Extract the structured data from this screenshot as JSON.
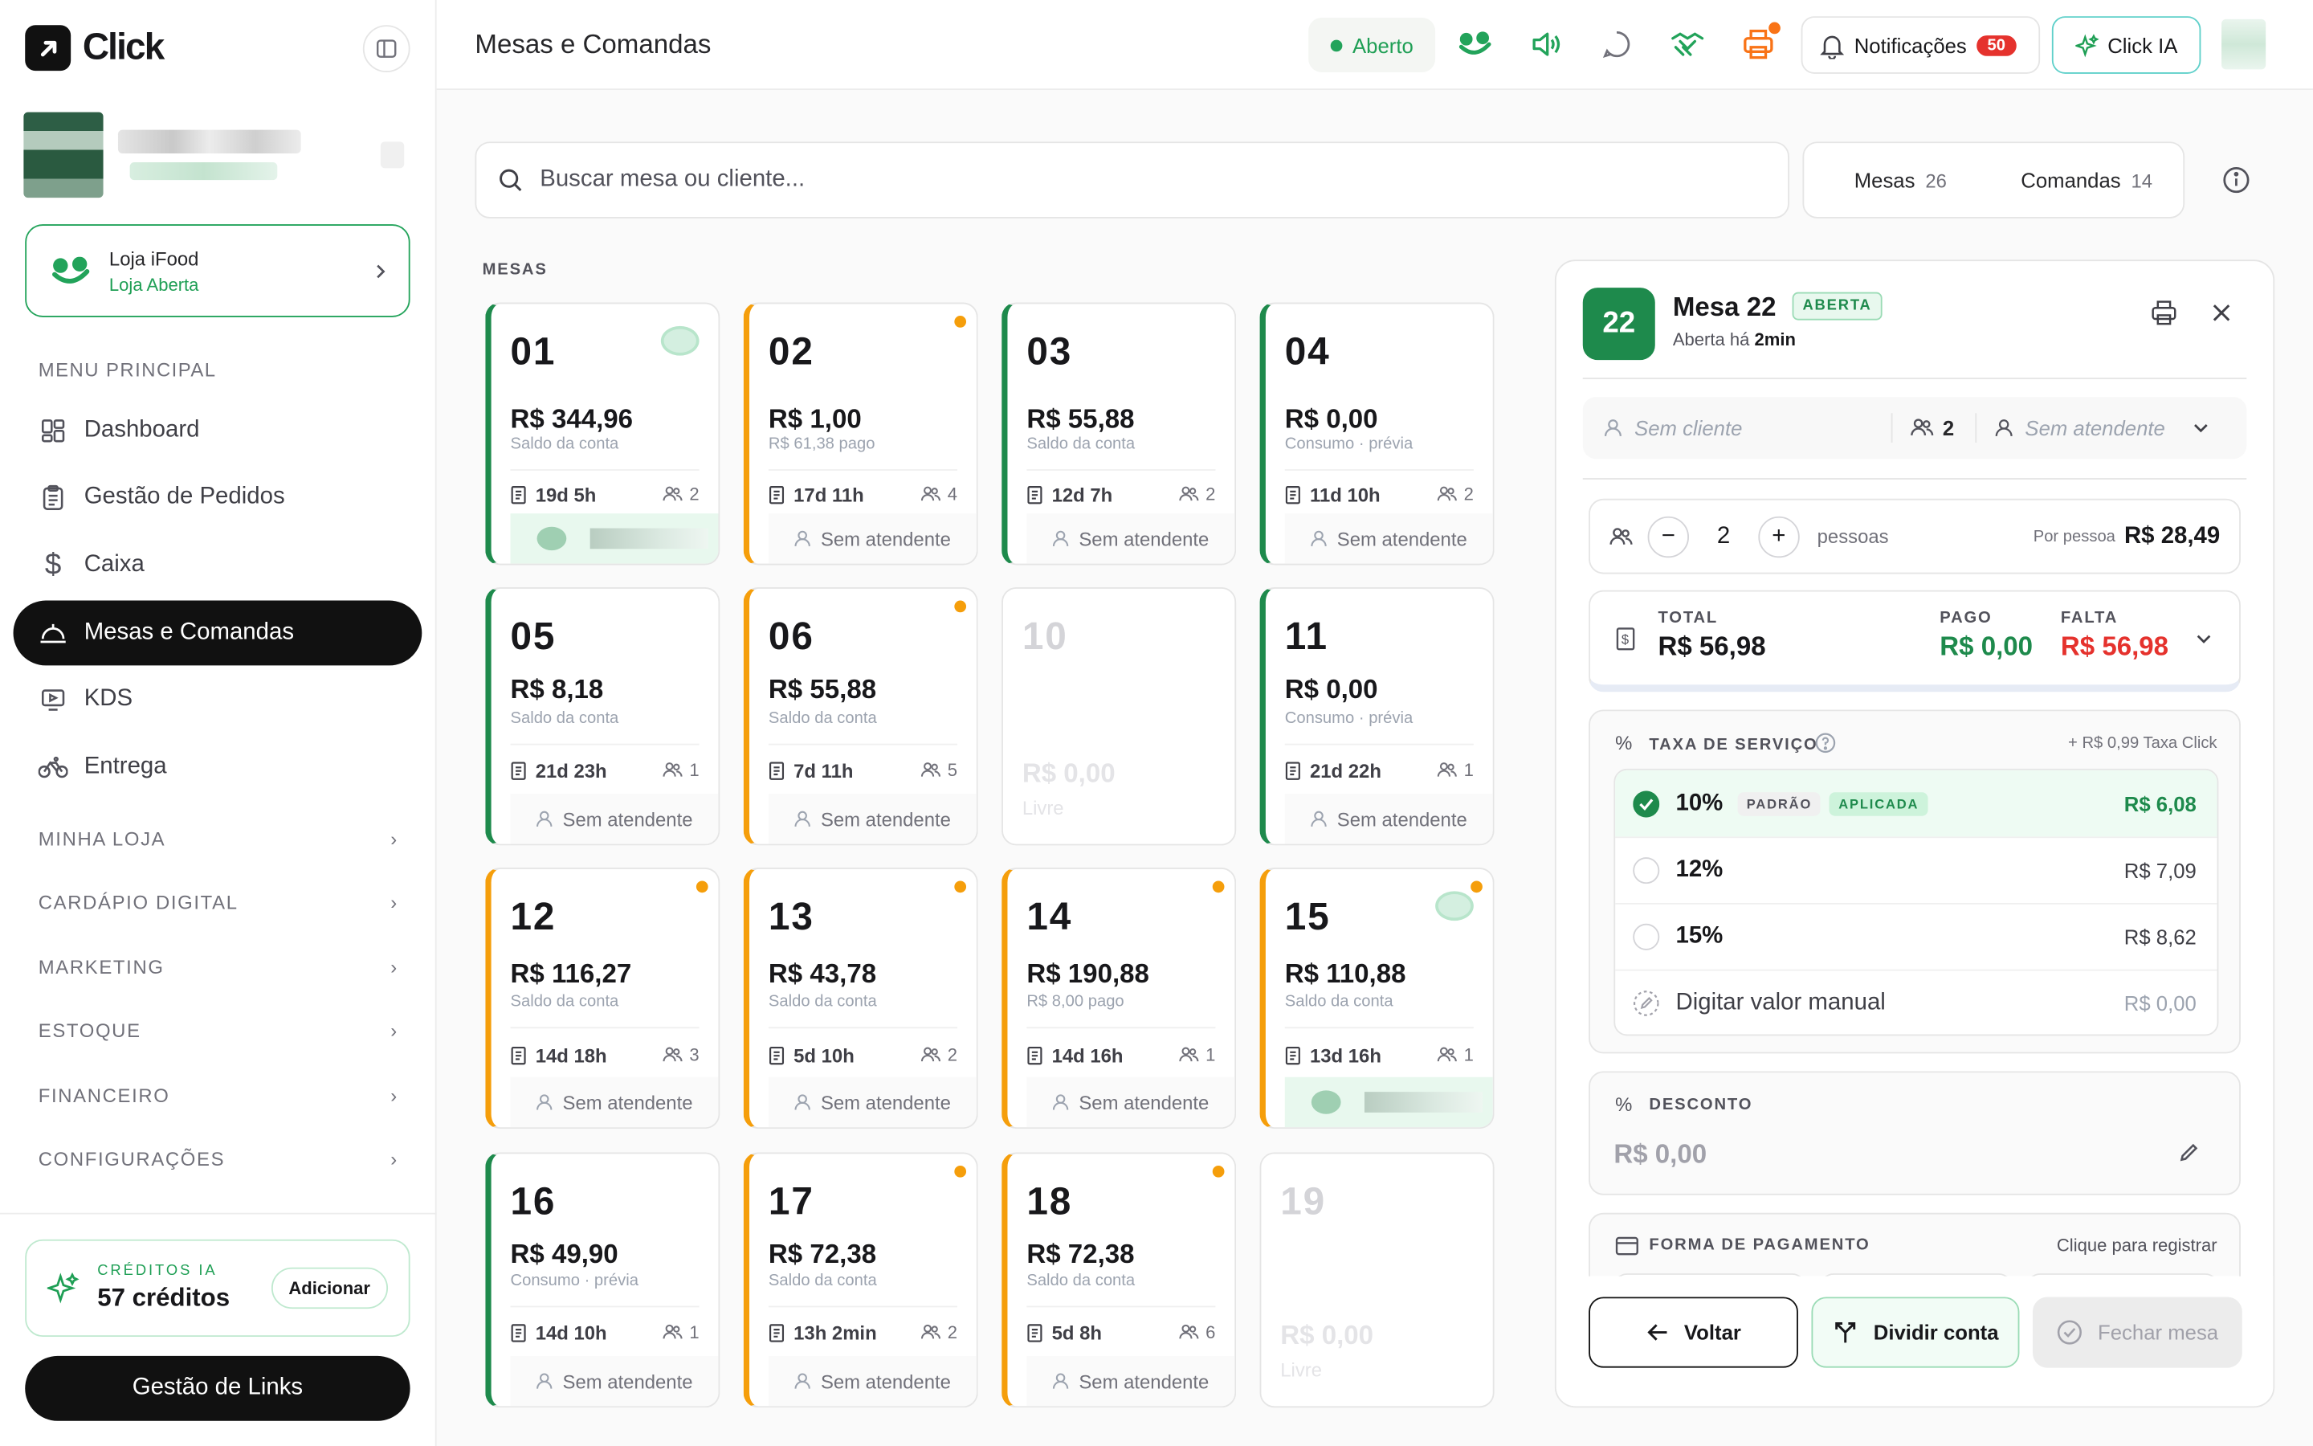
{
  "app": {
    "brand": "Click",
    "page_title": "Mesas e Comandas"
  },
  "sidebar": {
    "store": {
      "name": "Loja iFood",
      "status": "Loja Aberta"
    },
    "menu_label": "MENU PRINCIPAL",
    "items": [
      {
        "label": "Dashboard",
        "icon": "dashboard-icon"
      },
      {
        "label": "Gestão de Pedidos",
        "icon": "clipboard-icon"
      },
      {
        "label": "Caixa",
        "icon": "dollar-icon"
      },
      {
        "label": "Mesas e Comandas",
        "icon": "cloche-icon",
        "active": true
      },
      {
        "label": "KDS",
        "icon": "monitor-icon"
      },
      {
        "label": "Entrega",
        "icon": "bike-icon"
      }
    ],
    "groups": [
      "MINHA LOJA",
      "CARDÁPIO DIGITAL",
      "MARKETING",
      "ESTOQUE",
      "FINANCEIRO",
      "CONFIGURAÇÕES"
    ],
    "credits": {
      "label": "CRÉDITOS IA",
      "value": "57 créditos",
      "add_label": "Adicionar"
    },
    "links_button": "Gestão de Links"
  },
  "header": {
    "status": "Aberto",
    "notifications": {
      "label": "Notificações",
      "count": "50"
    },
    "ia_button": "Click IA"
  },
  "search": {
    "placeholder": "Buscar mesa ou cliente..."
  },
  "tabs": [
    {
      "label": "Mesas",
      "count": "26"
    },
    {
      "label": "Comandas",
      "count": "14"
    }
  ],
  "section_label": "MESAS",
  "tables": [
    {
      "num": "01",
      "amount": "R$ 344,96",
      "sub": "Saldo da conta",
      "time": "19d 5h",
      "people": "2",
      "attendant": "",
      "status": "open-green",
      "badge": true
    },
    {
      "num": "02",
      "amount": "R$ 1,00",
      "sub": "R$ 61,38 pago",
      "time": "17d 11h",
      "people": "4",
      "attendant": "Sem atendente",
      "status": "orange"
    },
    {
      "num": "03",
      "amount": "R$ 55,88",
      "sub": "Saldo da conta",
      "time": "12d 7h",
      "people": "2",
      "attendant": "Sem atendente",
      "status": "green"
    },
    {
      "num": "04",
      "amount": "R$ 0,00",
      "sub": "Consumo · prévia",
      "time": "11d 10h",
      "people": "2",
      "attendant": "Sem atendente",
      "status": "green"
    },
    {
      "num": "05",
      "amount": "R$ 8,18",
      "sub": "Saldo da conta",
      "time": "21d 23h",
      "people": "1",
      "attendant": "Sem atendente",
      "status": "green"
    },
    {
      "num": "06",
      "amount": "R$ 55,88",
      "sub": "Saldo da conta",
      "time": "7d 11h",
      "people": "5",
      "attendant": "Sem atendente",
      "status": "orange"
    },
    {
      "num": "10",
      "amount": "R$ 0,00",
      "sub": "Livre",
      "status": "free"
    },
    {
      "num": "11",
      "amount": "R$ 0,00",
      "sub": "Consumo · prévia",
      "time": "21d 22h",
      "people": "1",
      "attendant": "Sem atendente",
      "status": "green"
    },
    {
      "num": "12",
      "amount": "R$ 116,27",
      "sub": "Saldo da conta",
      "time": "14d 18h",
      "people": "3",
      "attendant": "Sem atendente",
      "status": "orange"
    },
    {
      "num": "13",
      "amount": "R$ 43,78",
      "sub": "Saldo da conta",
      "time": "5d 10h",
      "people": "2",
      "attendant": "Sem atendente",
      "status": "orange"
    },
    {
      "num": "14",
      "amount": "R$ 190,88",
      "sub": "R$ 8,00 pago",
      "time": "14d 16h",
      "people": "1",
      "attendant": "Sem atendente",
      "status": "orange"
    },
    {
      "num": "15",
      "amount": "R$ 110,88",
      "sub": "Saldo da conta",
      "time": "13d 16h",
      "people": "1",
      "attendant": "",
      "status": "orange",
      "badge": true
    },
    {
      "num": "16",
      "amount": "R$ 49,90",
      "sub": "Consumo · prévia",
      "time": "14d 10h",
      "people": "1",
      "attendant": "Sem atendente",
      "status": "green"
    },
    {
      "num": "17",
      "amount": "R$ 72,38",
      "sub": "Saldo da conta",
      "time": "13h 2min",
      "people": "2",
      "attendant": "Sem atendente",
      "status": "orange"
    },
    {
      "num": "18",
      "amount": "R$ 72,38",
      "sub": "Saldo da conta",
      "time": "5d 8h",
      "people": "6",
      "attendant": "Sem atendente",
      "status": "orange"
    },
    {
      "num": "19",
      "amount": "R$ 0,00",
      "sub": "Livre",
      "status": "free"
    }
  ],
  "detail": {
    "number": "22",
    "title": "Mesa 22",
    "status": "ABERTA",
    "opened_prefix": "Aberta há",
    "opened_value": "2min",
    "client": "Sem cliente",
    "people": "2",
    "attendant": "Sem atendente",
    "people_count": "2",
    "people_label": "pessoas",
    "per_person_label": "Por pessoa",
    "per_person_value": "R$ 28,49",
    "total_label": "TOTAL",
    "total_value": "R$ 56,98",
    "paid_label": "PAGO",
    "paid_value": "R$ 0,00",
    "due_label": "FALTA",
    "due_value": "R$ 56,98",
    "service": {
      "label": "TAXA DE SERVIÇO",
      "click_fee": "+ R$ 0,99 Taxa Click",
      "options": [
        {
          "pct": "10%",
          "value": "R$ 6,08",
          "tag1": "PADRÃO",
          "tag2": "APLICADA",
          "selected": true
        },
        {
          "pct": "12%",
          "value": "R$ 7,09"
        },
        {
          "pct": "15%",
          "value": "R$ 8,62"
        },
        {
          "pct": "Digitar valor manual",
          "value": "R$ 0,00"
        }
      ]
    },
    "discount": {
      "label": "DESCONTO",
      "value": "R$ 0,00"
    },
    "payment": {
      "label": "FORMA DE PAGAMENTO",
      "hint": "Clique para registrar"
    },
    "buttons": {
      "back": "Voltar",
      "split": "Dividir conta",
      "close": "Fechar mesa"
    }
  },
  "colors": {
    "brand_green": "#1e8a4c",
    "accent_orange": "#f59e0b",
    "danger": "#e5322d"
  }
}
